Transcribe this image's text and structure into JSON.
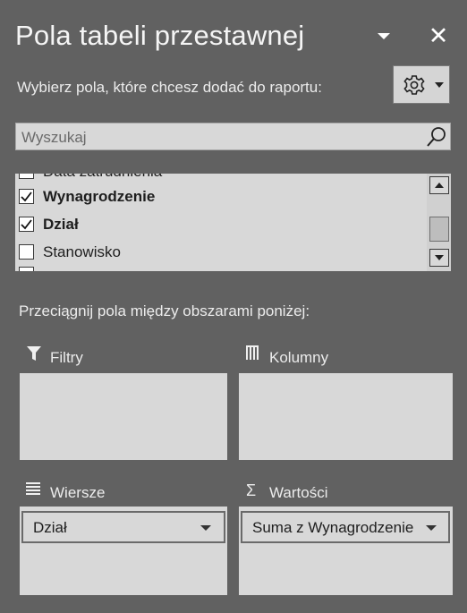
{
  "panel": {
    "title": "Pola tabeli przestawnej",
    "subtitle": "Wybierz pola, które chcesz dodać do raportu:",
    "icons": {
      "dropdown": "chevron-down-icon",
      "close": "close-icon",
      "settings": "gear-icon"
    },
    "close_glyph": "✕"
  },
  "search": {
    "placeholder": "Wyszukaj",
    "value": "",
    "icon": "search-icon"
  },
  "fields": [
    {
      "label": "Data zatrudnienia",
      "checked": false,
      "bold": false
    },
    {
      "label": "Wynagrodzenie",
      "checked": true,
      "bold": true
    },
    {
      "label": "Dział",
      "checked": true,
      "bold": true
    },
    {
      "label": "Stanowisko",
      "checked": false,
      "bold": false
    }
  ],
  "instructions": "Przeciągnij pola między obszarami poniżej:",
  "areas": {
    "filters": {
      "label": "Filtry",
      "icon": "filter-icon",
      "items": []
    },
    "columns": {
      "label": "Kolumny",
      "icon": "columns-icon",
      "items": []
    },
    "rows": {
      "label": "Wiersze",
      "icon": "rows-icon",
      "items": [
        "Dział"
      ]
    },
    "values": {
      "label": "Wartości",
      "icon": "sigma-icon",
      "glyph": "Σ",
      "items": [
        "Suma z Wynagrodzenie"
      ]
    }
  },
  "colors": {
    "panel_bg": "#616161",
    "zone_bg": "#d8d8d8",
    "text": "#f2f2f2"
  }
}
